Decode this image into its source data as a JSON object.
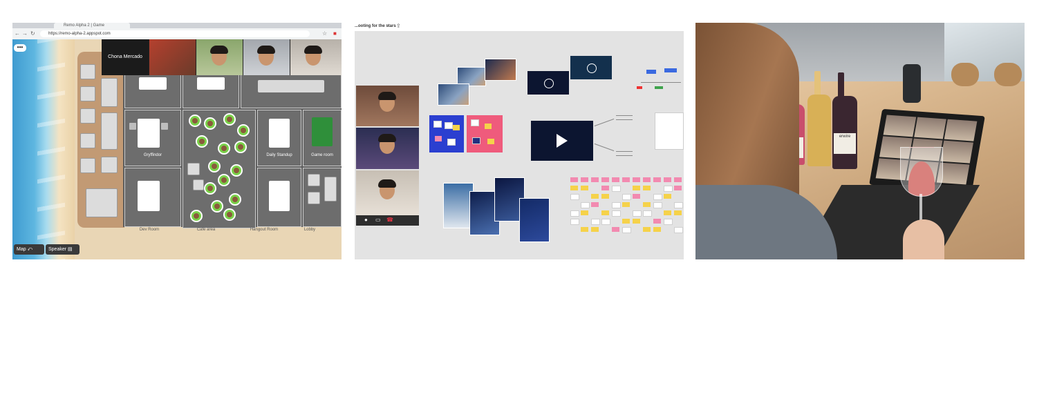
{
  "panel1": {
    "browser": {
      "tab_title": "Remo Alpha 2 | Game",
      "url": "https://remo-alpha-2.appspot.com"
    },
    "video_strip": {
      "speaker_name": "Chona Mercado"
    },
    "menu_dots": "•••",
    "rooms": {
      "gryffindor": "Gryffindor",
      "daily_standup": "Daily Standup",
      "game_room": "Game room"
    },
    "bottom_labels": [
      "Dev Room",
      "Cafe area",
      "Hangout Room",
      "Lobby"
    ],
    "controls": {
      "map_label": "Map",
      "speaker_label": "Speaker"
    },
    "colors": {
      "avatar_ring": "#7ad14a",
      "floor": "#5e5e5e"
    }
  },
  "panel2": {
    "board_title": "...ooting for the stars",
    "icons": [
      "close-icon",
      "share-icon",
      "mic-icon",
      "camera-icon",
      "hangup-icon",
      "play-icon"
    ],
    "colors": {
      "sticky_yellow": "#f5d24a",
      "sticky_pink": "#f28ab0",
      "video_bg": "#0c1530"
    }
  },
  "panel3": {
    "bottle_label": "erwire"
  }
}
